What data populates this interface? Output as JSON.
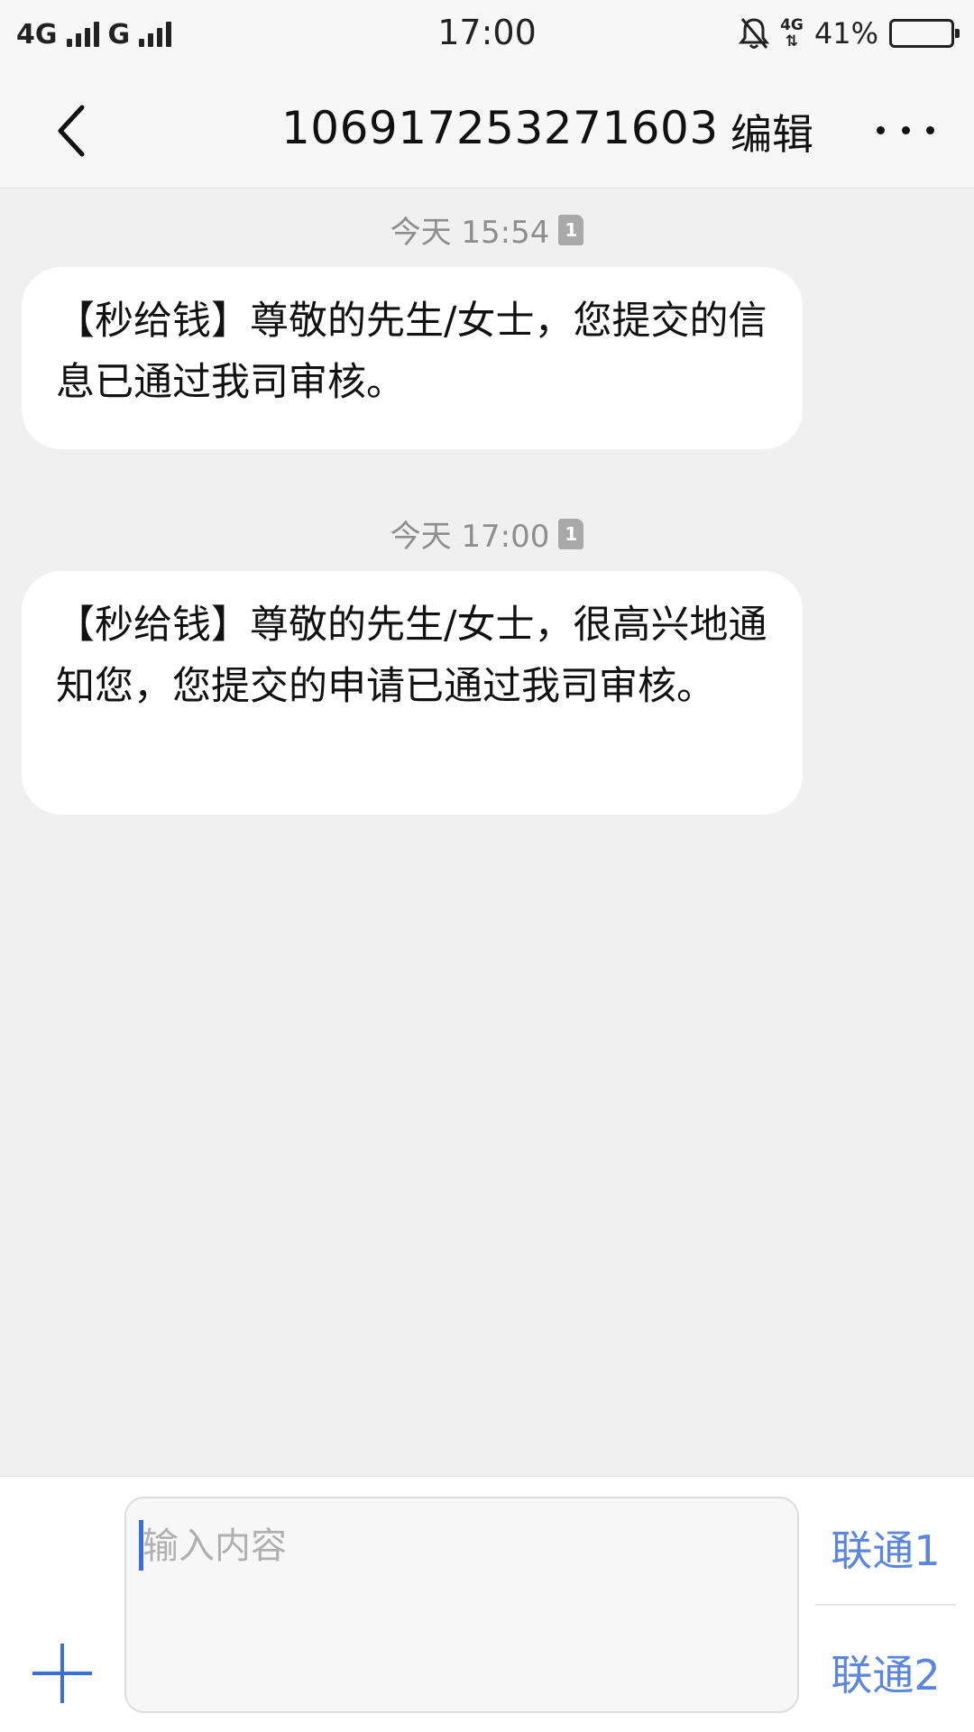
{
  "status_bar": {
    "network1": "4G",
    "network2": "G",
    "time": "17:00",
    "net_small": "4G",
    "battery_percent": "41%",
    "battery_level": 0.41
  },
  "header": {
    "title": "106917253271603",
    "edit_label": "编辑"
  },
  "messages": [
    {
      "timestamp": "今天 15:54",
      "sim": "1",
      "text": "【秒给钱】尊敬的先生/女士，您提交的信息已通过我司审核。"
    },
    {
      "timestamp": "今天 17:00",
      "sim": "1",
      "text": "【秒给钱】尊敬的先生/女士，很高兴地通知您，您提交的申请已通过我司审核。"
    }
  ],
  "composer": {
    "placeholder": "输入内容",
    "send_sim1": "联通1",
    "send_sim2": "联通2"
  },
  "colors": {
    "accent": "#3a6fd8",
    "send_text": "#5b86e0",
    "background": "#f0f0f0",
    "bubble": "#ffffff"
  }
}
